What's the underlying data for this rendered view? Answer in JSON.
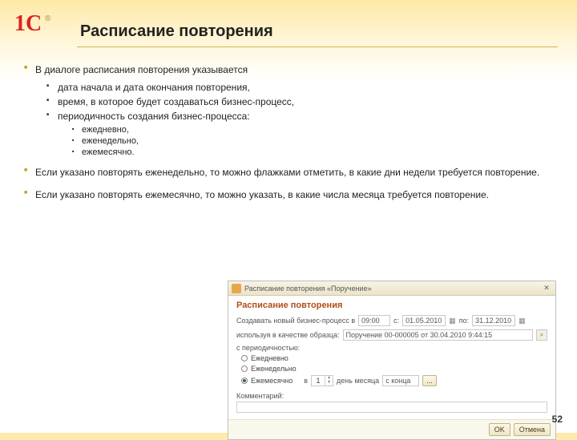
{
  "slide": {
    "title": "Расписание повторения",
    "pagenum": "52"
  },
  "bullets": {
    "main1": "В диалоге расписания повторения указывается",
    "sub1": "дата начала и дата окончания повторения,",
    "sub2": "время, в которое будет создаваться бизнес-процесс,",
    "sub3": "периодичность создания бизнес-процесса:",
    "subsub1": "ежедневно,",
    "subsub2": "еженедельно,",
    "subsub3": "ежемесячно.",
    "main2": "Если указано повторять еженедельно, то можно флажками отметить, в какие дни недели требуется повторение.",
    "main3": "Если указано повторять ежемесячно, то можно указать, в какие числа месяца требуется повторение."
  },
  "dialog": {
    "window_title": "Расписание повторения «Поручение»",
    "heading": "Расписание повторения",
    "create_label": "Создавать новый бизнес-процесс в",
    "time_value": "09:00",
    "from_label": "с:",
    "from_value": "01.05.2010",
    "to_label": "по:",
    "to_value": "31.12.2010",
    "sample_label": "используя в качестве образца:",
    "sample_value": "Поручение 00-000005 от 30.04.2010 9:44:15",
    "period_label": "с периодичностью:",
    "radio_daily": "Ежедневно",
    "radio_weekly": "Еженедельно",
    "radio_monthly": "Ежемесячно",
    "monthly_in": "в",
    "monthly_day_value": "1",
    "monthly_day_label": "день месяца",
    "monthly_from_label": "с конца",
    "monthly_more": "...",
    "comment_label": "Комментарий:",
    "ok": "OK",
    "cancel": "Отмена"
  }
}
